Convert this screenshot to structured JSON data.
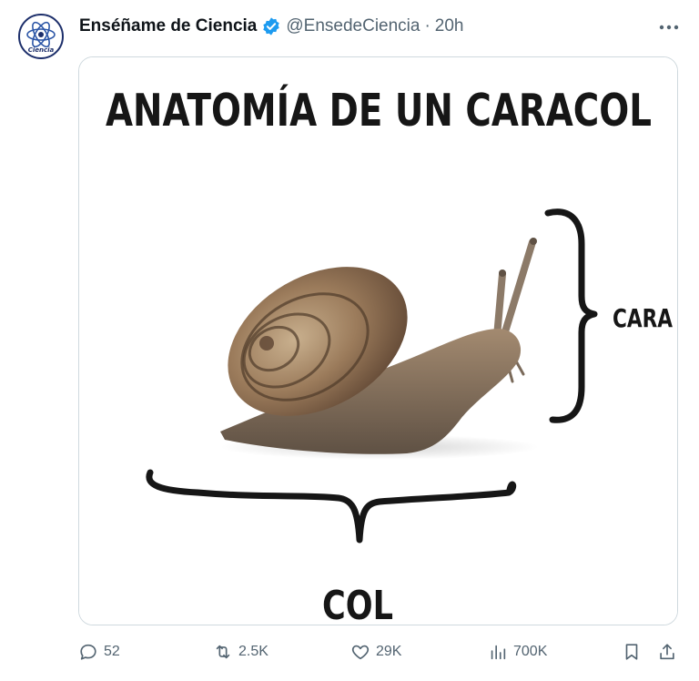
{
  "tweet": {
    "display_name": "Enséñame de Ciencia",
    "handle": "@EnsedeCiencia",
    "separator": "·",
    "time": "20h",
    "verified": true,
    "avatar_icon": "atom-logo-icon",
    "avatar_text": "Ciencia"
  },
  "media": {
    "title": "ANATOMÍA DE UN CARACOL",
    "label_right": "CARA",
    "label_bottom": "COL",
    "subject_icon": "snail-illustration"
  },
  "actions": {
    "replies": "52",
    "reposts": "2.5K",
    "likes": "29K",
    "views": "700K",
    "bookmark_icon": "bookmark-icon",
    "share_icon": "share-icon"
  },
  "colors": {
    "text_primary": "#0f1419",
    "text_secondary": "#536471",
    "verified_blue": "#1d9bf0",
    "border": "#cfd9de"
  }
}
